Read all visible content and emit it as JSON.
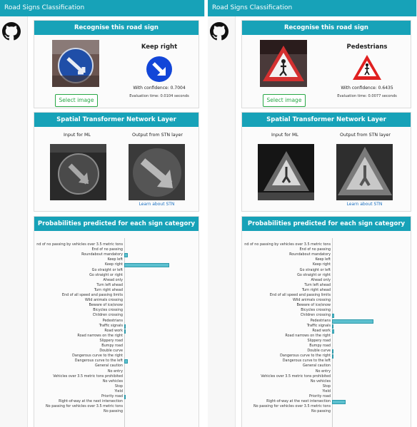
{
  "panels": [
    {
      "app_title": "Road Signs Classification",
      "recognise": {
        "title": "Recognise this road sign",
        "prediction": "Keep right",
        "confidence": "With confidence: 0.7004",
        "eval_time": "Evaluation time: 0.0104 seconds",
        "select_label": "Select image"
      },
      "stn": {
        "title": "Spatial Transformer Network Layer",
        "input_label": "Input for ML",
        "output_label": "Output from STN layer",
        "learn_link": "Learn about STN"
      },
      "probs": {
        "title": "Probabilities predicted for each sign category"
      }
    },
    {
      "app_title": "Road Signs Classification",
      "recognise": {
        "title": "Recognise this road sign",
        "prediction": "Pedestrians",
        "confidence": "With confidence: 0.6435",
        "eval_time": "Evaluation time: 0.0077 seconds",
        "select_label": "Select image"
      },
      "stn": {
        "title": "Spatial Transformer Network Layer",
        "input_label": "Input for ML",
        "output_label": "Output from STN layer",
        "learn_link": "Learn about STN"
      },
      "probs": {
        "title": "Probabilities predicted for each sign category"
      }
    }
  ],
  "chart_data": [
    {
      "type": "bar",
      "orientation": "horizontal",
      "categories": [
        "nd of no passing by vehicles over 3.5 metric tons",
        "End of no passing",
        "Roundabout mandatory",
        "Keep left",
        "Keep right",
        "Go straight or left",
        "Go straight or right",
        "Ahead only",
        "Turn left ahead",
        "Turn right ahead",
        "End of all speed and passing limits",
        "Wild animals crossing",
        "Beware of ice/snow",
        "Bicycles crossing",
        "Children crossing",
        "Pedestrians",
        "Traffic signals",
        "Road work",
        "Road narrows on the right",
        "Slippery road",
        "Bumpy road",
        "Double curve",
        "Dangerous curve to the right",
        "Dangerous curve to the left",
        "General caution",
        "No entry",
        "Vehicles over 3.5 metric tons prohibited",
        "No vehicles",
        "Stop",
        "Yield",
        "Priority road",
        "Right-of-way at the next intersection",
        "No passing for vehicles over 3.5 metric tons",
        "No passing"
      ],
      "values": [
        0,
        0,
        0.06,
        0,
        0.7,
        0,
        0,
        0,
        0,
        0,
        0,
        0,
        0,
        0,
        0,
        0,
        0.02,
        0.02,
        0,
        0,
        0,
        0,
        0,
        0.06,
        0,
        0,
        0,
        0,
        0,
        0,
        0.01,
        0,
        0,
        0
      ]
    },
    {
      "type": "bar",
      "orientation": "horizontal",
      "categories": [
        "nd of no passing by vehicles over 3.5 metric tons",
        "End of no passing",
        "Roundabout mandatory",
        "Keep left",
        "Keep right",
        "Go straight or left",
        "Go straight or right",
        "Ahead only",
        "Turn left ahead",
        "Turn right ahead",
        "End of all speed and passing limits",
        "Wild animals crossing",
        "Beware of ice/snow",
        "Bicycles crossing",
        "Children crossing",
        "Pedestrians",
        "Traffic signals",
        "Road work",
        "Road narrows on the right",
        "Slippery road",
        "Bumpy road",
        "Double curve",
        "Dangerous curve to the right",
        "Dangerous curve to the left",
        "General caution",
        "No entry",
        "Vehicles over 3.5 metric tons prohibited",
        "No vehicles",
        "Stop",
        "Yield",
        "Priority road",
        "Right-of-way at the next intersection",
        "No passing for vehicles over 3.5 metric tons",
        "No passing"
      ],
      "values": [
        0,
        0,
        0,
        0,
        0,
        0,
        0,
        0,
        0,
        0,
        0,
        0,
        0,
        0,
        0.03,
        0.64,
        0.02,
        0.03,
        0,
        0,
        0,
        0.01,
        0.01,
        0,
        0,
        0,
        0,
        0,
        0,
        0,
        0,
        0.21,
        0,
        0
      ]
    }
  ]
}
